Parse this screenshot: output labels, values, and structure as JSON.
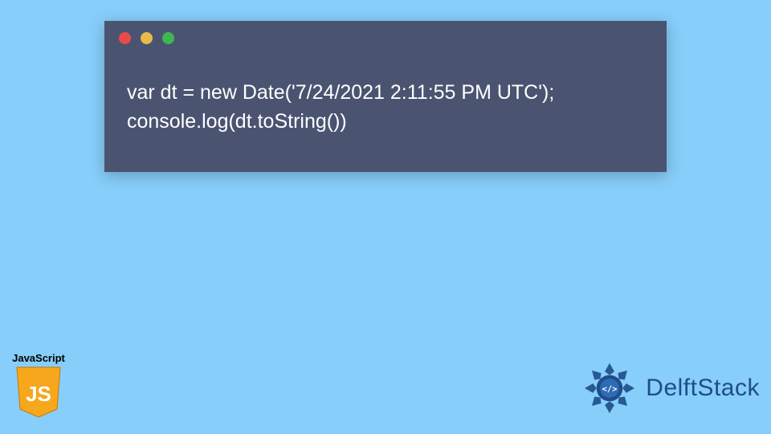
{
  "code": {
    "line1": "var dt = new Date('7/24/2021 2:11:55 PM UTC');",
    "line2": "console.log(dt.toString())"
  },
  "badges": {
    "js_label": "JavaScript",
    "js_letters": "JS",
    "delft_text": "DelftStack"
  },
  "colors": {
    "bg": "#87cefa",
    "window": "#4a5471",
    "js_yellow": "#f7a71c",
    "delft_blue": "#1e4d8a"
  }
}
